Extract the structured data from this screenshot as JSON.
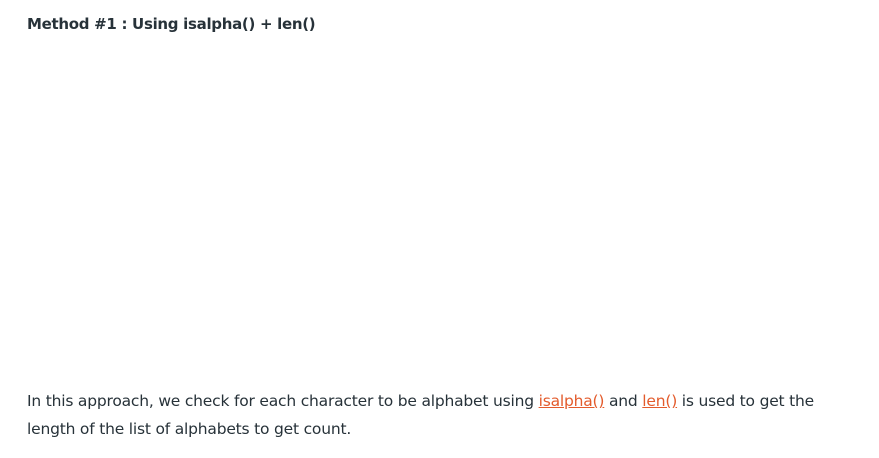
{
  "heading": "Method #1 : Using isalpha() + len()",
  "paragraph": {
    "part1": "In this approach, we check for each character to be alphabet using ",
    "link1": "isalpha()",
    "part2": " and ",
    "link2": "len()",
    "part3": " is used to get the length of the list of alphabets to get count."
  },
  "colors": {
    "link": "#e35b2c",
    "text": "#273239"
  }
}
